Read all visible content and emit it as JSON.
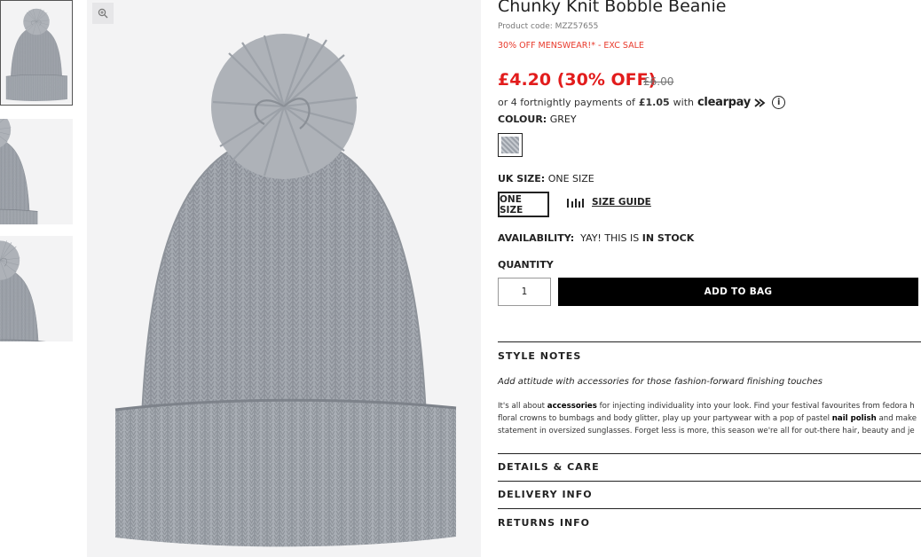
{
  "product": {
    "title": "Chunky Knit Bobble Beanie",
    "code": "Product code: MZZ57655",
    "promo": "30% OFF MENSWEAR!* - EXC SALE",
    "price": "£4.20 (30% OFF)",
    "was_price": "£6.00"
  },
  "payment": {
    "prefix": "or 4 fortnightly payments of",
    "amount": "£1.05",
    "with": "with",
    "provider": "clearpay",
    "info_icon": "i"
  },
  "colour": {
    "label": "COLOUR:",
    "value": "GREY"
  },
  "size": {
    "label": "UK SIZE:",
    "value": "ONE SIZE",
    "option": "ONE SIZE",
    "guide": "SIZE GUIDE"
  },
  "availability": {
    "label": "AVAILABILITY:",
    "prefix": "YAY! THIS IS",
    "status": "IN STOCK"
  },
  "quantity": {
    "label": "QUANTITY",
    "value": "1"
  },
  "add_to_bag": "ADD TO BAG",
  "sections": {
    "style_notes": "STYLE NOTES",
    "tagline": "Add attitude with accessories for those fashion-forward finishing touches",
    "line1_a": "It's all about",
    "line1_b": "accessories",
    "line1_c": "for injecting individuality into your look. Find your festival favourites from fedora h",
    "line2_a": "floral crowns to bumbags and body glitter, play up your partywear with a pop of pastel",
    "line2_b": "nail polish",
    "line2_c": "and make",
    "line3": "statement in oversized sunglasses. Forget less is more, this season we're all for out-there hair, beauty and je",
    "details": "DETAILS & CARE",
    "delivery": "DELIVERY INFO",
    "returns": "RETURNS INFO"
  },
  "icons": {
    "zoom": "zoom-in-icon",
    "size_guide": "ruler-icon"
  }
}
